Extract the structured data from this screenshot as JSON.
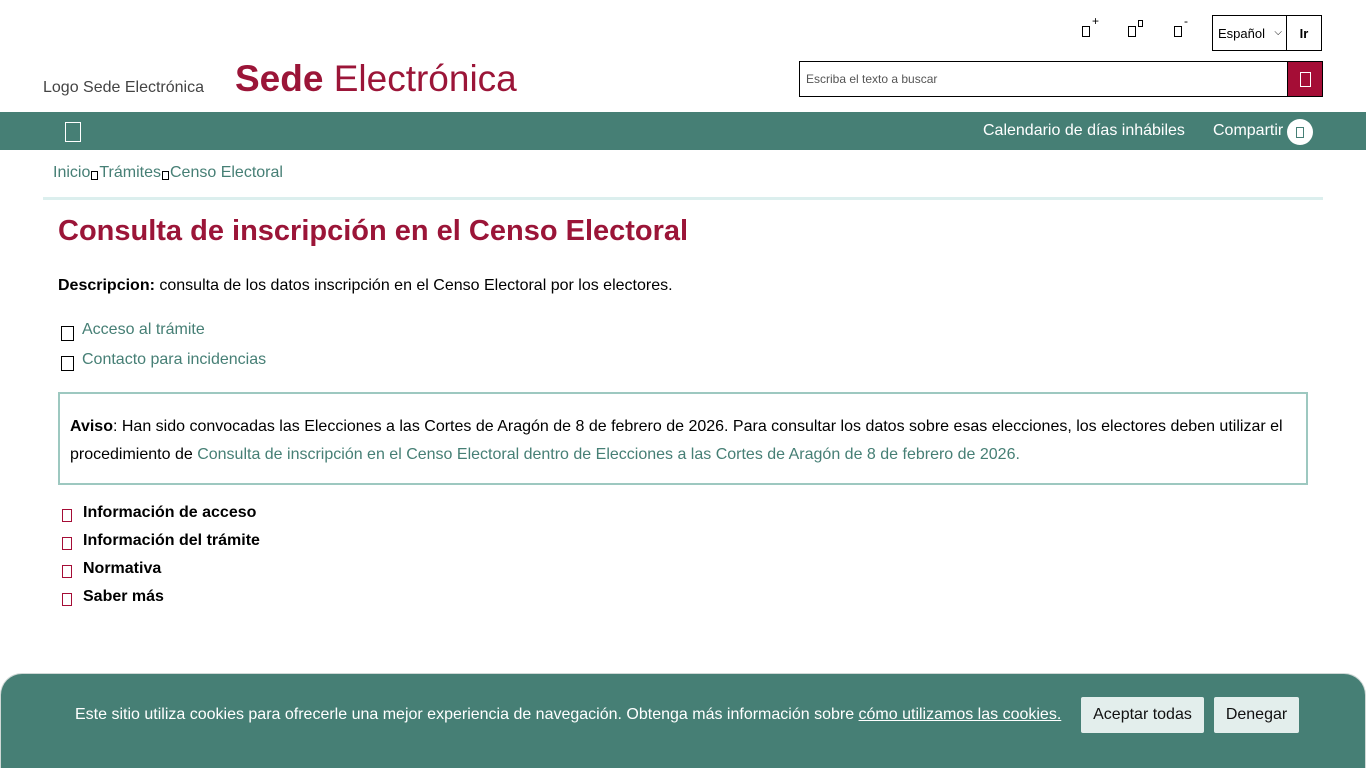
{
  "header": {
    "font_controls": [
      {
        "name": "increase",
        "sup": "+"
      },
      {
        "name": "reset",
        "sup": ""
      },
      {
        "name": "decrease",
        "sup": "-"
      }
    ],
    "language": {
      "selected": "Español",
      "go_label": "Ir"
    },
    "logo_alt": "Logo Sede Electrónica",
    "title_bold": "Sede",
    "title_rest": "Electrónica",
    "search": {
      "placeholder": "Escriba el texto a buscar"
    }
  },
  "nav": {
    "calendar": "Calendario de días inhábiles",
    "share": "Compartir"
  },
  "breadcrumb": [
    "Inicio",
    "Trámites",
    "Censo Electoral"
  ],
  "main": {
    "title": "Consulta de inscripción en el Censo Electoral",
    "desc_label": "Descripcion:",
    "desc_text": " consulta de los datos inscripción en el Censo Electoral por los electores.",
    "links": [
      "Acceso al trámite",
      "Contacto para incidencias"
    ],
    "aviso": {
      "label": "Aviso",
      "text": ": Han sido convocadas las Elecciones a las Cortes de Aragón de 8 de febrero de 2026. Para consultar los datos sobre esas elecciones, los electores deben utilizar el procedimiento de ",
      "link": "Consulta de inscripción en el Censo Electoral dentro de Elecciones a las Cortes de Aragón de 8 de febrero de 2026",
      "end": "."
    },
    "sections": [
      "Información de acceso",
      "Información del trámite",
      "Normativa",
      "Saber más"
    ]
  },
  "cookie": {
    "text": "Este sitio utiliza cookies para ofrecerle una mejor experiencia de navegación. Obtenga más información sobre ",
    "link": "cómo utilizamos las cookies.",
    "accept": "Aceptar todas",
    "deny": "Denegar"
  },
  "colors": {
    "brand": "#9b1538",
    "teal": "#467f75",
    "accent_button": "#a50d36"
  }
}
